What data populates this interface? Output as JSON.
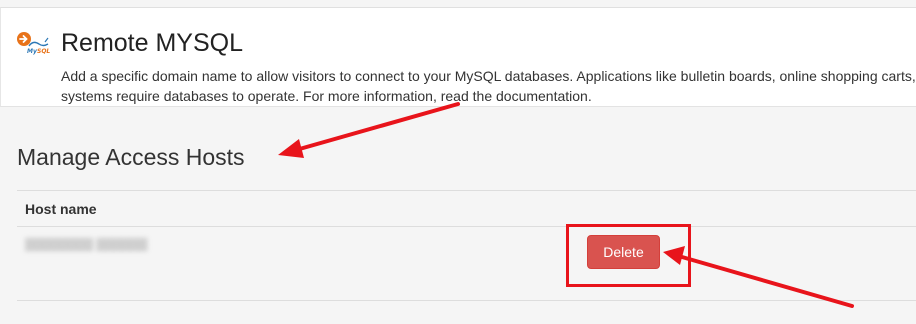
{
  "header": {
    "icon": "mysql-remote-icon",
    "title": "Remote MYSQL",
    "description_line1": "Add a specific domain name to allow visitors to connect to your MySQL databases. Applications like bulletin boards, online shopping carts,",
    "description_line2": "systems require databases to operate. For more information, read the documentation."
  },
  "section": {
    "title": "Manage Access Hosts"
  },
  "table": {
    "columns": [
      "Host name"
    ],
    "rows": [
      {
        "host": "",
        "action_label": "Delete"
      }
    ]
  },
  "annotations": {
    "color": "#e8141b",
    "arrows": [
      "arrow-to-section-title",
      "arrow-to-delete-button"
    ],
    "highlight": "delete-button-highlight-box"
  },
  "colors": {
    "danger": "#d9534f",
    "background": "#f5f5f5",
    "panel": "#ffffff"
  }
}
